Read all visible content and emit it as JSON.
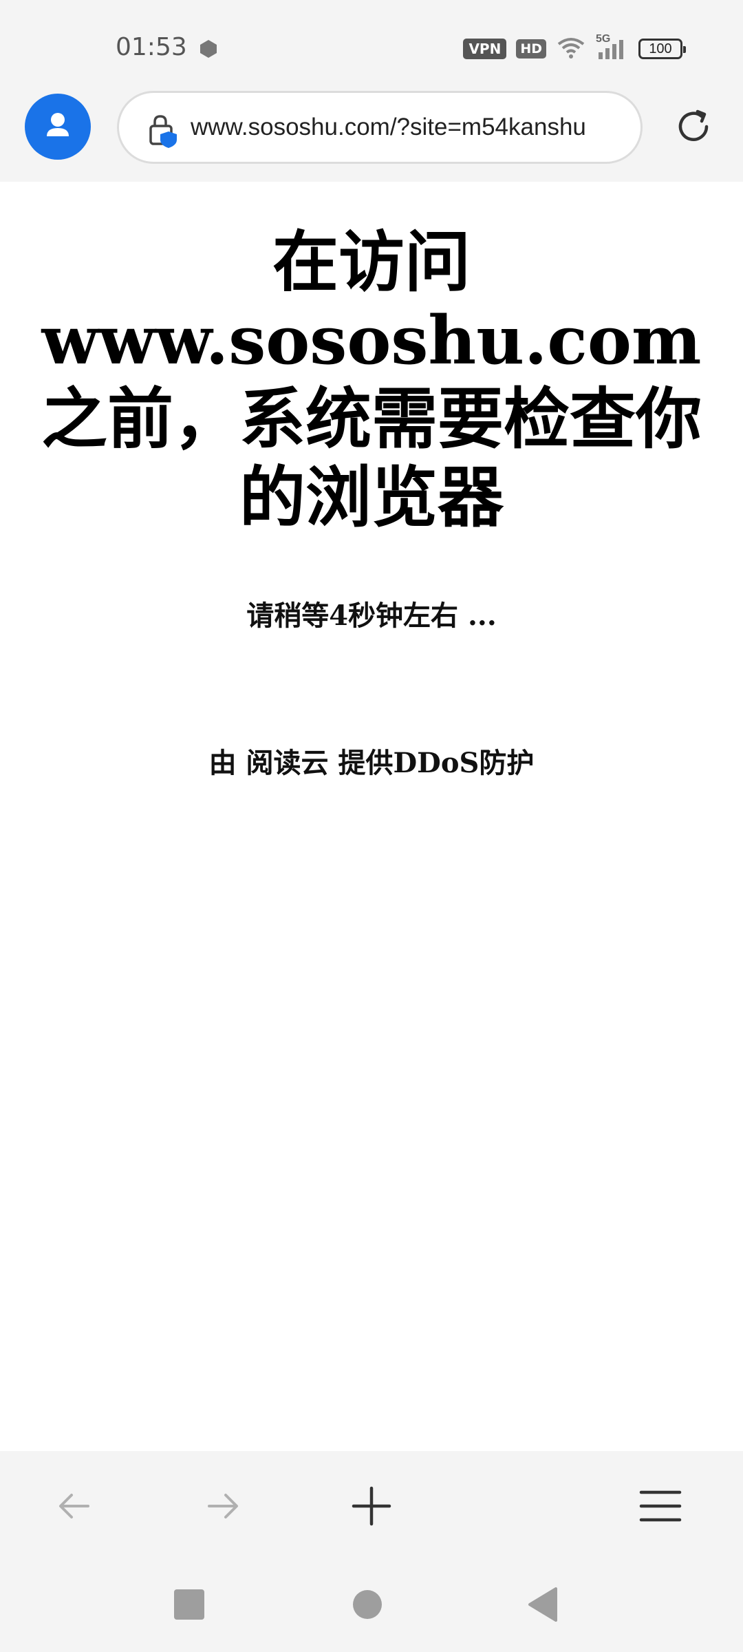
{
  "status": {
    "time": "01:53",
    "vpn_label": "VPN",
    "hd_label": "HD",
    "network_label": "5G",
    "battery": "100"
  },
  "browser": {
    "url": "www.sososhu.com/?site=m54kanshu"
  },
  "page": {
    "heading": "在访问 www.sososhu.com 之前，系统需要检查你的浏览器",
    "wait_text": "请稍等4秒钟左右 ...",
    "ddos_text": "由 阅读云 提供DDoS防护"
  },
  "colors": {
    "accent": "#1a73e8",
    "toolbar_bg": "#f4f4f4",
    "icon_gray": "#9e9e9e"
  }
}
